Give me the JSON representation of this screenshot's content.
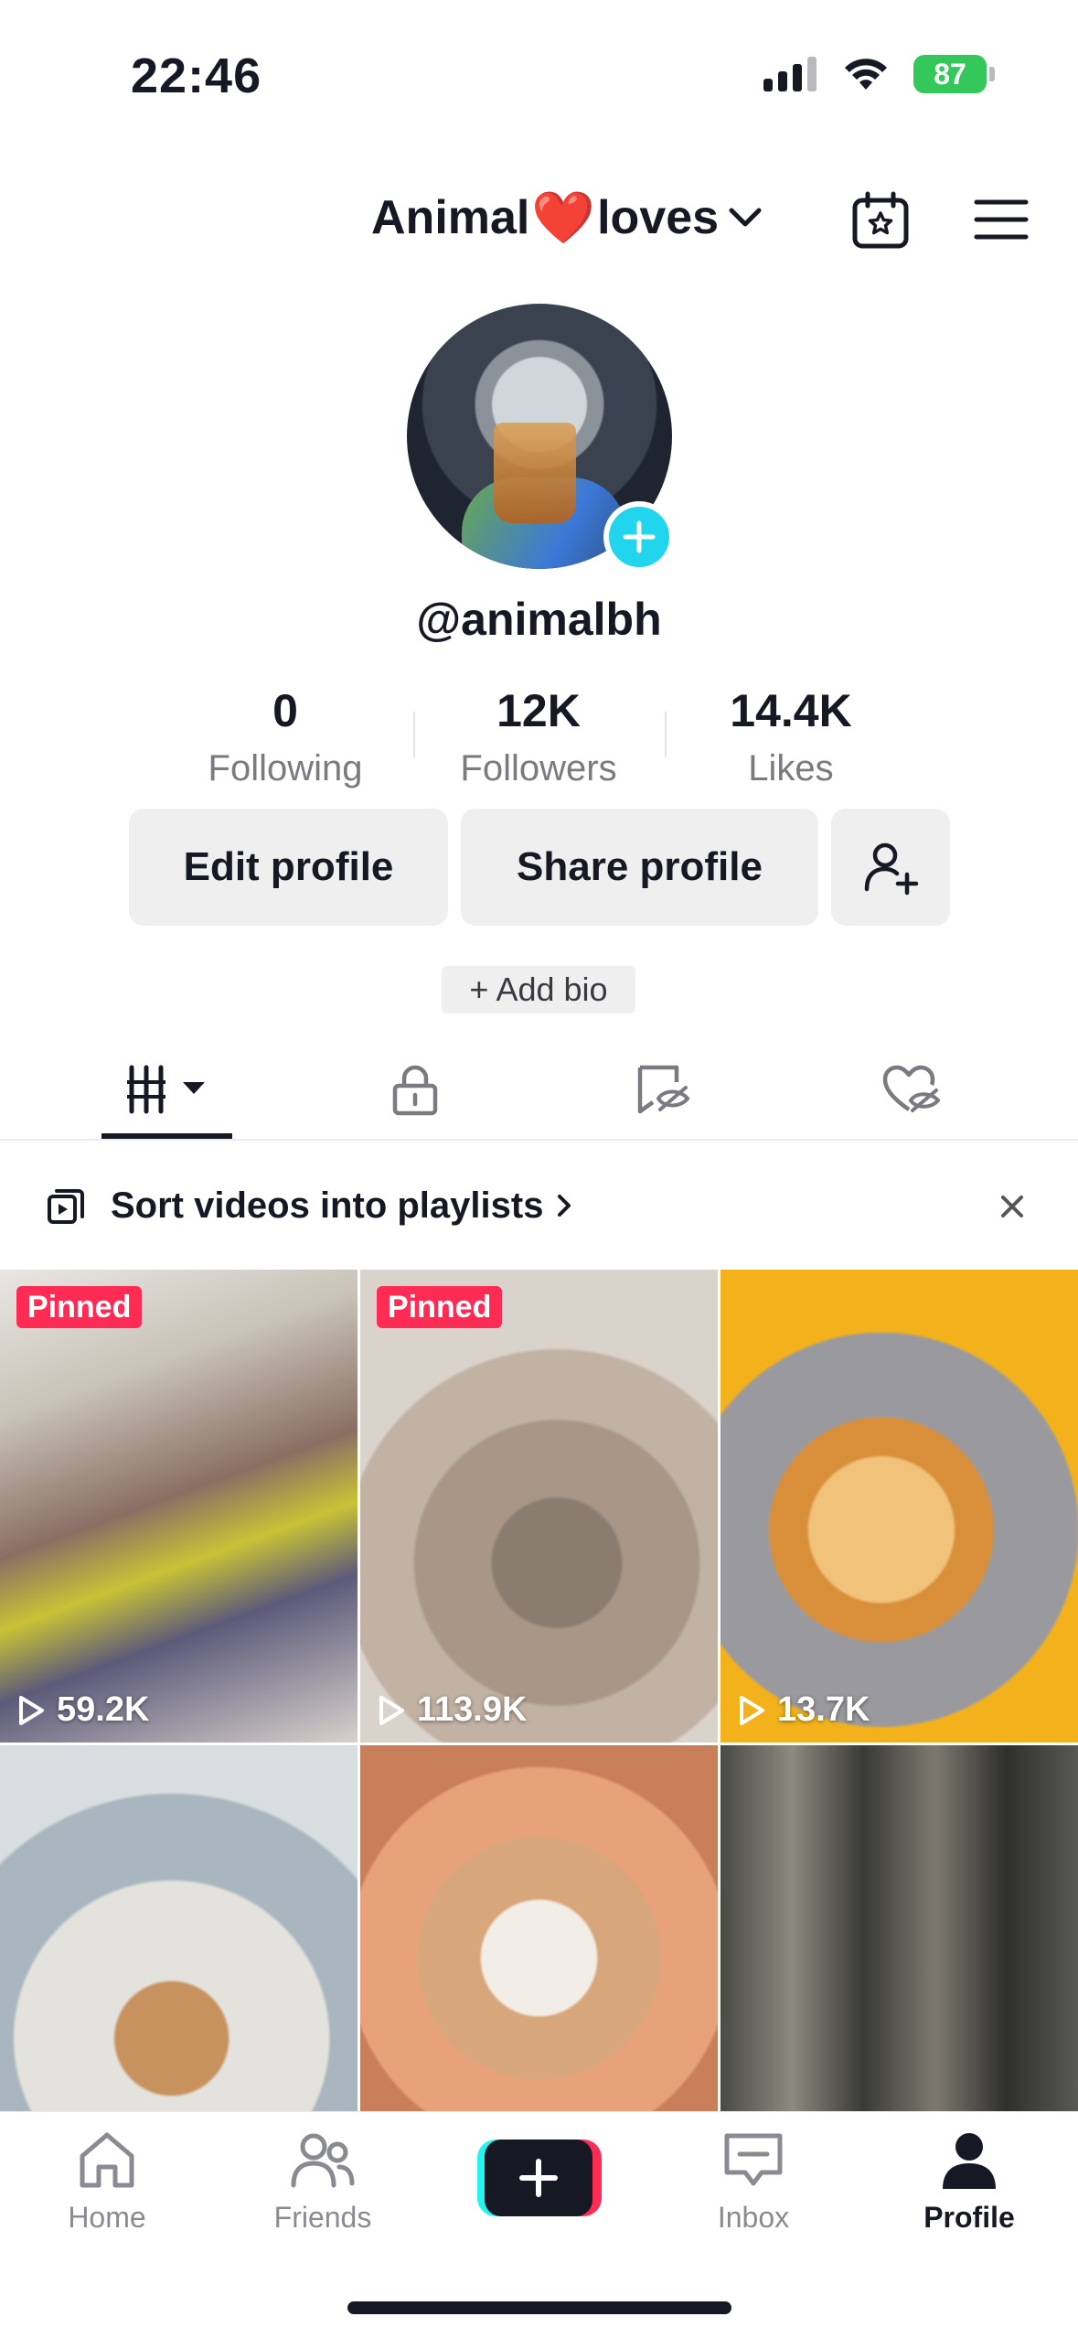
{
  "status_bar": {
    "time": "22:46",
    "battery": "87"
  },
  "header": {
    "title_left": "Animal",
    "title_heart": "❤️",
    "title_right": "loves"
  },
  "profile": {
    "username": "@animalbh",
    "stats": [
      {
        "value": "0",
        "label": "Following"
      },
      {
        "value": "12K",
        "label": "Followers"
      },
      {
        "value": "14.4K",
        "label": "Likes"
      }
    ],
    "edit_label": "Edit profile",
    "share_label": "Share profile",
    "add_bio_label": "+ Add bio"
  },
  "banner": {
    "text": "Sort videos into playlists"
  },
  "videos": [
    {
      "pinned": "Pinned",
      "views": "59.2K"
    },
    {
      "pinned": "Pinned",
      "views": "113.9K"
    },
    {
      "pinned": "",
      "views": "13.7K"
    },
    {
      "pinned": "",
      "views": ""
    },
    {
      "pinned": "",
      "views": ""
    },
    {
      "pinned": "",
      "views": ""
    }
  ],
  "nav": [
    {
      "label": "Home"
    },
    {
      "label": "Friends"
    },
    {
      "label": "Inbox"
    },
    {
      "label": "Profile"
    }
  ],
  "colors": {
    "accent": "#fe2c55",
    "cyan": "#20d5ec",
    "battery": "#34c759"
  }
}
